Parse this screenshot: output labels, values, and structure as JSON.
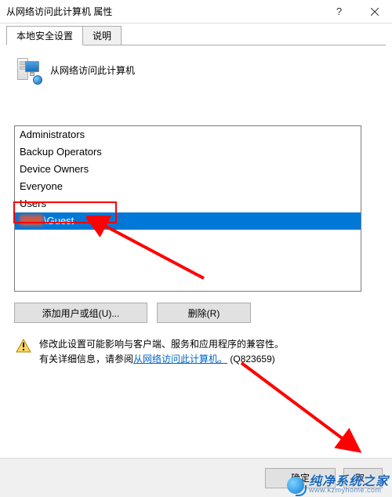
{
  "window": {
    "title": "从网络访问此计算机 属性",
    "help_label": "?",
    "close_label": "×"
  },
  "tabs": {
    "active": "本地安全设置",
    "inactive": "说明"
  },
  "policy": {
    "name": "从网络访问此计算机"
  },
  "list": {
    "items": [
      "Administrators",
      "Backup Operators",
      "Device Owners",
      "Everyone",
      "Users"
    ],
    "selected": "\\Guest"
  },
  "buttons": {
    "add": "添加用户或组(U)...",
    "remove": "删除(R)"
  },
  "warning": {
    "line1_a": "修改此设置可能影响与客户端、服务和应用程序的兼容性。",
    "line2_a": "有关详细信息，请参阅",
    "link": "从网络访问此计算机。",
    "line2_b": " (Q823659)"
  },
  "bottom": {
    "ok": "确定",
    "cancel_visible": "取"
  },
  "watermark": {
    "cn": "纯净系统之家",
    "en": "www.kzmyhome.com"
  }
}
